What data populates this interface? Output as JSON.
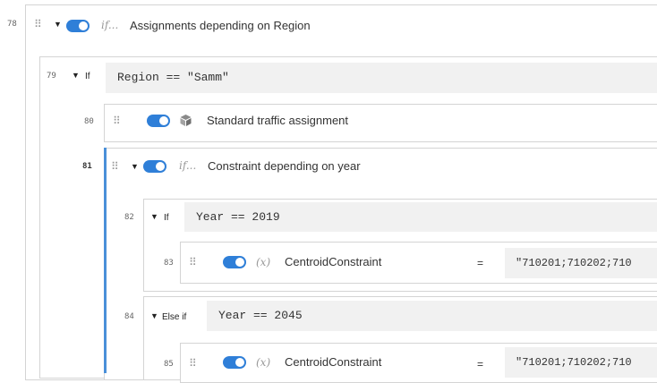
{
  "row78": {
    "line": "78",
    "label": "Assignments depending on Region",
    "prefix": "if..."
  },
  "row79": {
    "line": "79",
    "keyword": "If",
    "expression": "Region == \"Samm\""
  },
  "row80": {
    "line": "80",
    "label": "Standard traffic assignment"
  },
  "row81": {
    "line": "81",
    "label": "Constraint depending on year",
    "prefix": "if..."
  },
  "row82": {
    "line": "82",
    "keyword": "If",
    "expression": "Year == 2019"
  },
  "row83": {
    "line": "83",
    "var_prefix": "(x)",
    "name": "CentroidConstraint",
    "eq": "=",
    "value": "\"710201;710202;710"
  },
  "row84": {
    "line": "84",
    "keyword": "Else if",
    "expression": "Year == 2045"
  },
  "row85": {
    "line": "85",
    "var_prefix": "(x)",
    "name": "CentroidConstraint",
    "eq": "=",
    "value": "\"710201;710202;710"
  },
  "colors": {
    "toggle": "#2f7fd8",
    "selection_bar": "#4a90d9",
    "border": "#d4d4d4",
    "expression_bg": "#f1f1f1"
  },
  "icons": [
    "drag-handle-icon",
    "expand-triangle-icon",
    "toggle-switch",
    "cube-icon",
    "variable-icon"
  ]
}
